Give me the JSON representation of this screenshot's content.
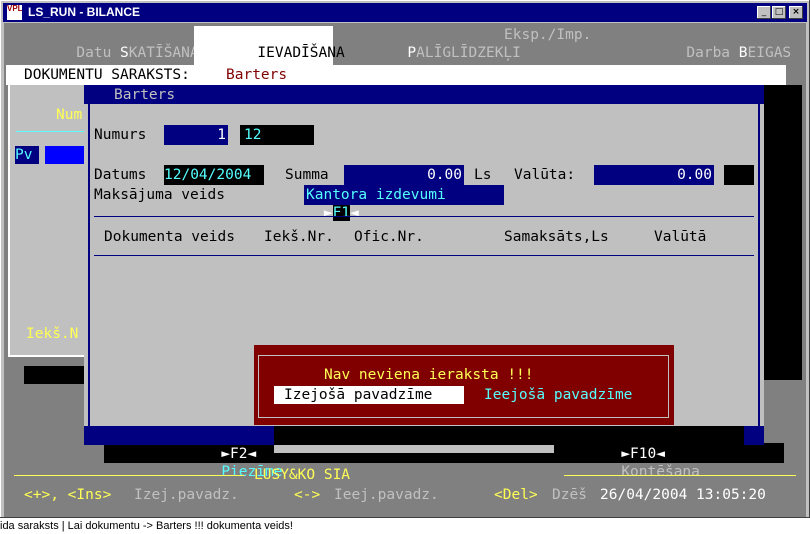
{
  "window": {
    "title": "LS_RUN - BILANCE",
    "icon_text": "VPLS",
    "minimize_glyph": "_",
    "maximize_glyph": "□",
    "close_glyph": "×"
  },
  "menu": [
    {
      "pre": "Datu ",
      "hk": "S",
      "post": "KATĪŠANA"
    },
    {
      "pre": "",
      "hk": "I",
      "post": "EVADĪŠANA"
    },
    {
      "pre": "",
      "hk": "P",
      "post": "ALĪGLĪDZEKĻI"
    },
    {
      "pre": "Eksp./Imp.",
      "hk": "",
      "post": ""
    },
    {
      "pre": "Darba ",
      "hk": "B",
      "post": "EIGAS"
    }
  ],
  "list_window": {
    "title_label": "DOKUMENTU SARAKSTS: ",
    "title_value": "Barters",
    "col_fragment": "Num",
    "row_fragment": "Pv",
    "bottom_fragment": "Iekš.N"
  },
  "dialog": {
    "title": "Barters",
    "numurs_label": "Numurs",
    "numurs_value": "1",
    "numurs_value2": "12",
    "datums_label": "Datums",
    "datums_value": "12/04/2004",
    "summa_label": "Summa",
    "summa_value": "0.00",
    "ls_label": "Ls",
    "valuta_label": "Valūta:",
    "valuta_value": "0.00",
    "maksajuma_label": "Maksājuma veids",
    "f1_key": "F1",
    "maksajuma_value": "Kantora izdevumi",
    "columns": [
      "Dokumenta veids",
      "Iekš.Nr.",
      "Ofic.Nr.",
      "Samaksāts,Ls",
      "Valūtā"
    ],
    "f2_key": "F2",
    "f2_label": "Piezīme",
    "f10_key": "F10",
    "f10_label": "Kontēšana"
  },
  "alert": {
    "message": "Nav neviena ieraksta !!!",
    "option1": "Izejošā pavadzīme",
    "option2": "Ieejošā pavadzīme"
  },
  "footer": {
    "company": "LUSY&KO SIA",
    "hint1": "<+>, <Ins>",
    "hint1_text": "Izej.pavadz.",
    "hint2": "<->",
    "hint2_text": "Ieej.pavadz.",
    "hint3": "<Del>",
    "hint3_text": "Dzēš",
    "datetime": "26/04/2004 13:05:20"
  },
  "status_bar": "ida saraksts | Lai dokumentu -> Barters !!! dokumenta veids!",
  "colors": {
    "screen_bg": "#808080",
    "dialog_bg": "#c0c0c0",
    "navy": "#000080",
    "yellow": "#ffff55",
    "cyan": "#55ffff",
    "alert_bg": "#800000"
  }
}
